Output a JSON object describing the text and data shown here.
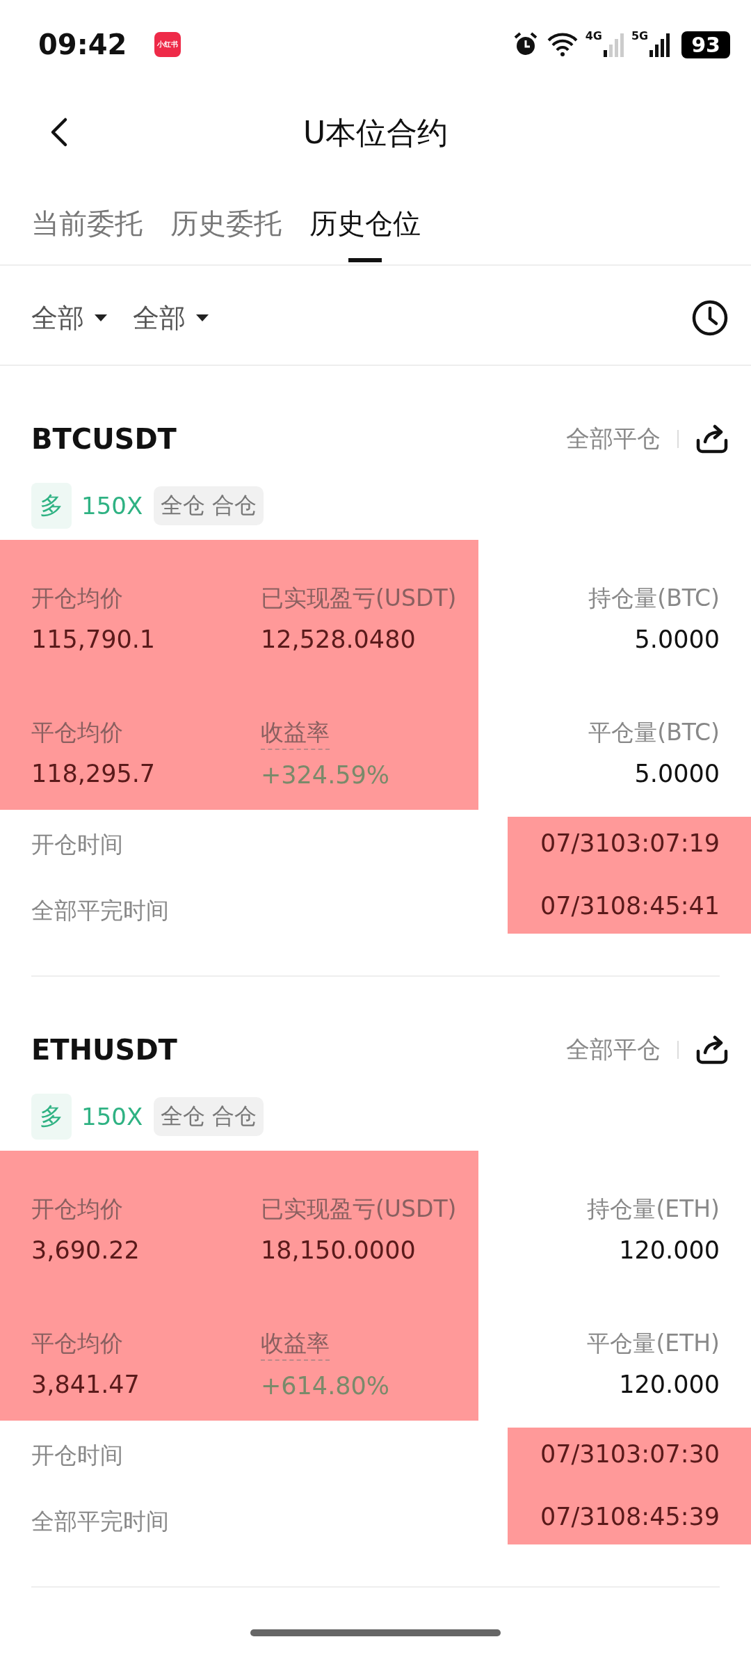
{
  "status_bar": {
    "time": "09:42",
    "app_badge": "小红书",
    "network_1": "4G",
    "network_2": "5G",
    "battery": "93"
  },
  "header": {
    "title": "U本位合约"
  },
  "tabs": [
    {
      "label": "当前委托",
      "selected": false
    },
    {
      "label": "历史委托",
      "selected": false
    },
    {
      "label": "历史仓位",
      "selected": true
    }
  ],
  "filters": [
    {
      "label": "全部"
    },
    {
      "label": "全部"
    }
  ],
  "positions": [
    {
      "symbol": "BTCUSDT",
      "close_all": "全部平仓",
      "side": "多",
      "leverage": "150X",
      "mode": "全仓 合仓",
      "stats_highlighted": true,
      "stats": [
        {
          "label": "开仓均价",
          "value": "115,790.1",
          "kind": "plain"
        },
        {
          "label": "已实现盈亏(USDT)",
          "value": "12,528.0480",
          "kind": "plain"
        },
        {
          "label": "平仓均价",
          "value": "118,295.7",
          "kind": "plain"
        },
        {
          "label": "收益率",
          "value": "+324.59%",
          "kind": "rate"
        }
      ],
      "amounts": [
        {
          "label": "持仓量(BTC)",
          "value": "5.0000"
        },
        {
          "label": "平仓量(BTC)",
          "value": "5.0000"
        }
      ],
      "times_highlighted": true,
      "times": [
        {
          "label": "开仓时间",
          "value": "07/3103:07:19"
        },
        {
          "label": "全部平完时间",
          "value": "07/3108:45:41"
        }
      ]
    },
    {
      "symbol": "ETHUSDT",
      "close_all": "全部平仓",
      "side": "多",
      "leverage": "150X",
      "mode": "全仓 合仓",
      "stats_highlighted": true,
      "stats": [
        {
          "label": "开仓均价",
          "value": "3,690.22",
          "kind": "plain"
        },
        {
          "label": "已实现盈亏(USDT)",
          "value": "18,150.0000",
          "kind": "plain"
        },
        {
          "label": "平仓均价",
          "value": "3,841.47",
          "kind": "plain"
        },
        {
          "label": "收益率",
          "value": "+614.80%",
          "kind": "rate"
        }
      ],
      "amounts": [
        {
          "label": "持仓量(ETH)",
          "value": "120.000"
        },
        {
          "label": "平仓量(ETH)",
          "value": "120.000"
        }
      ],
      "times_highlighted": true,
      "times": [
        {
          "label": "开仓时间",
          "value": "07/3103:07:30"
        },
        {
          "label": "全部平完时间",
          "value": "07/3108:45:39"
        }
      ]
    }
  ]
}
